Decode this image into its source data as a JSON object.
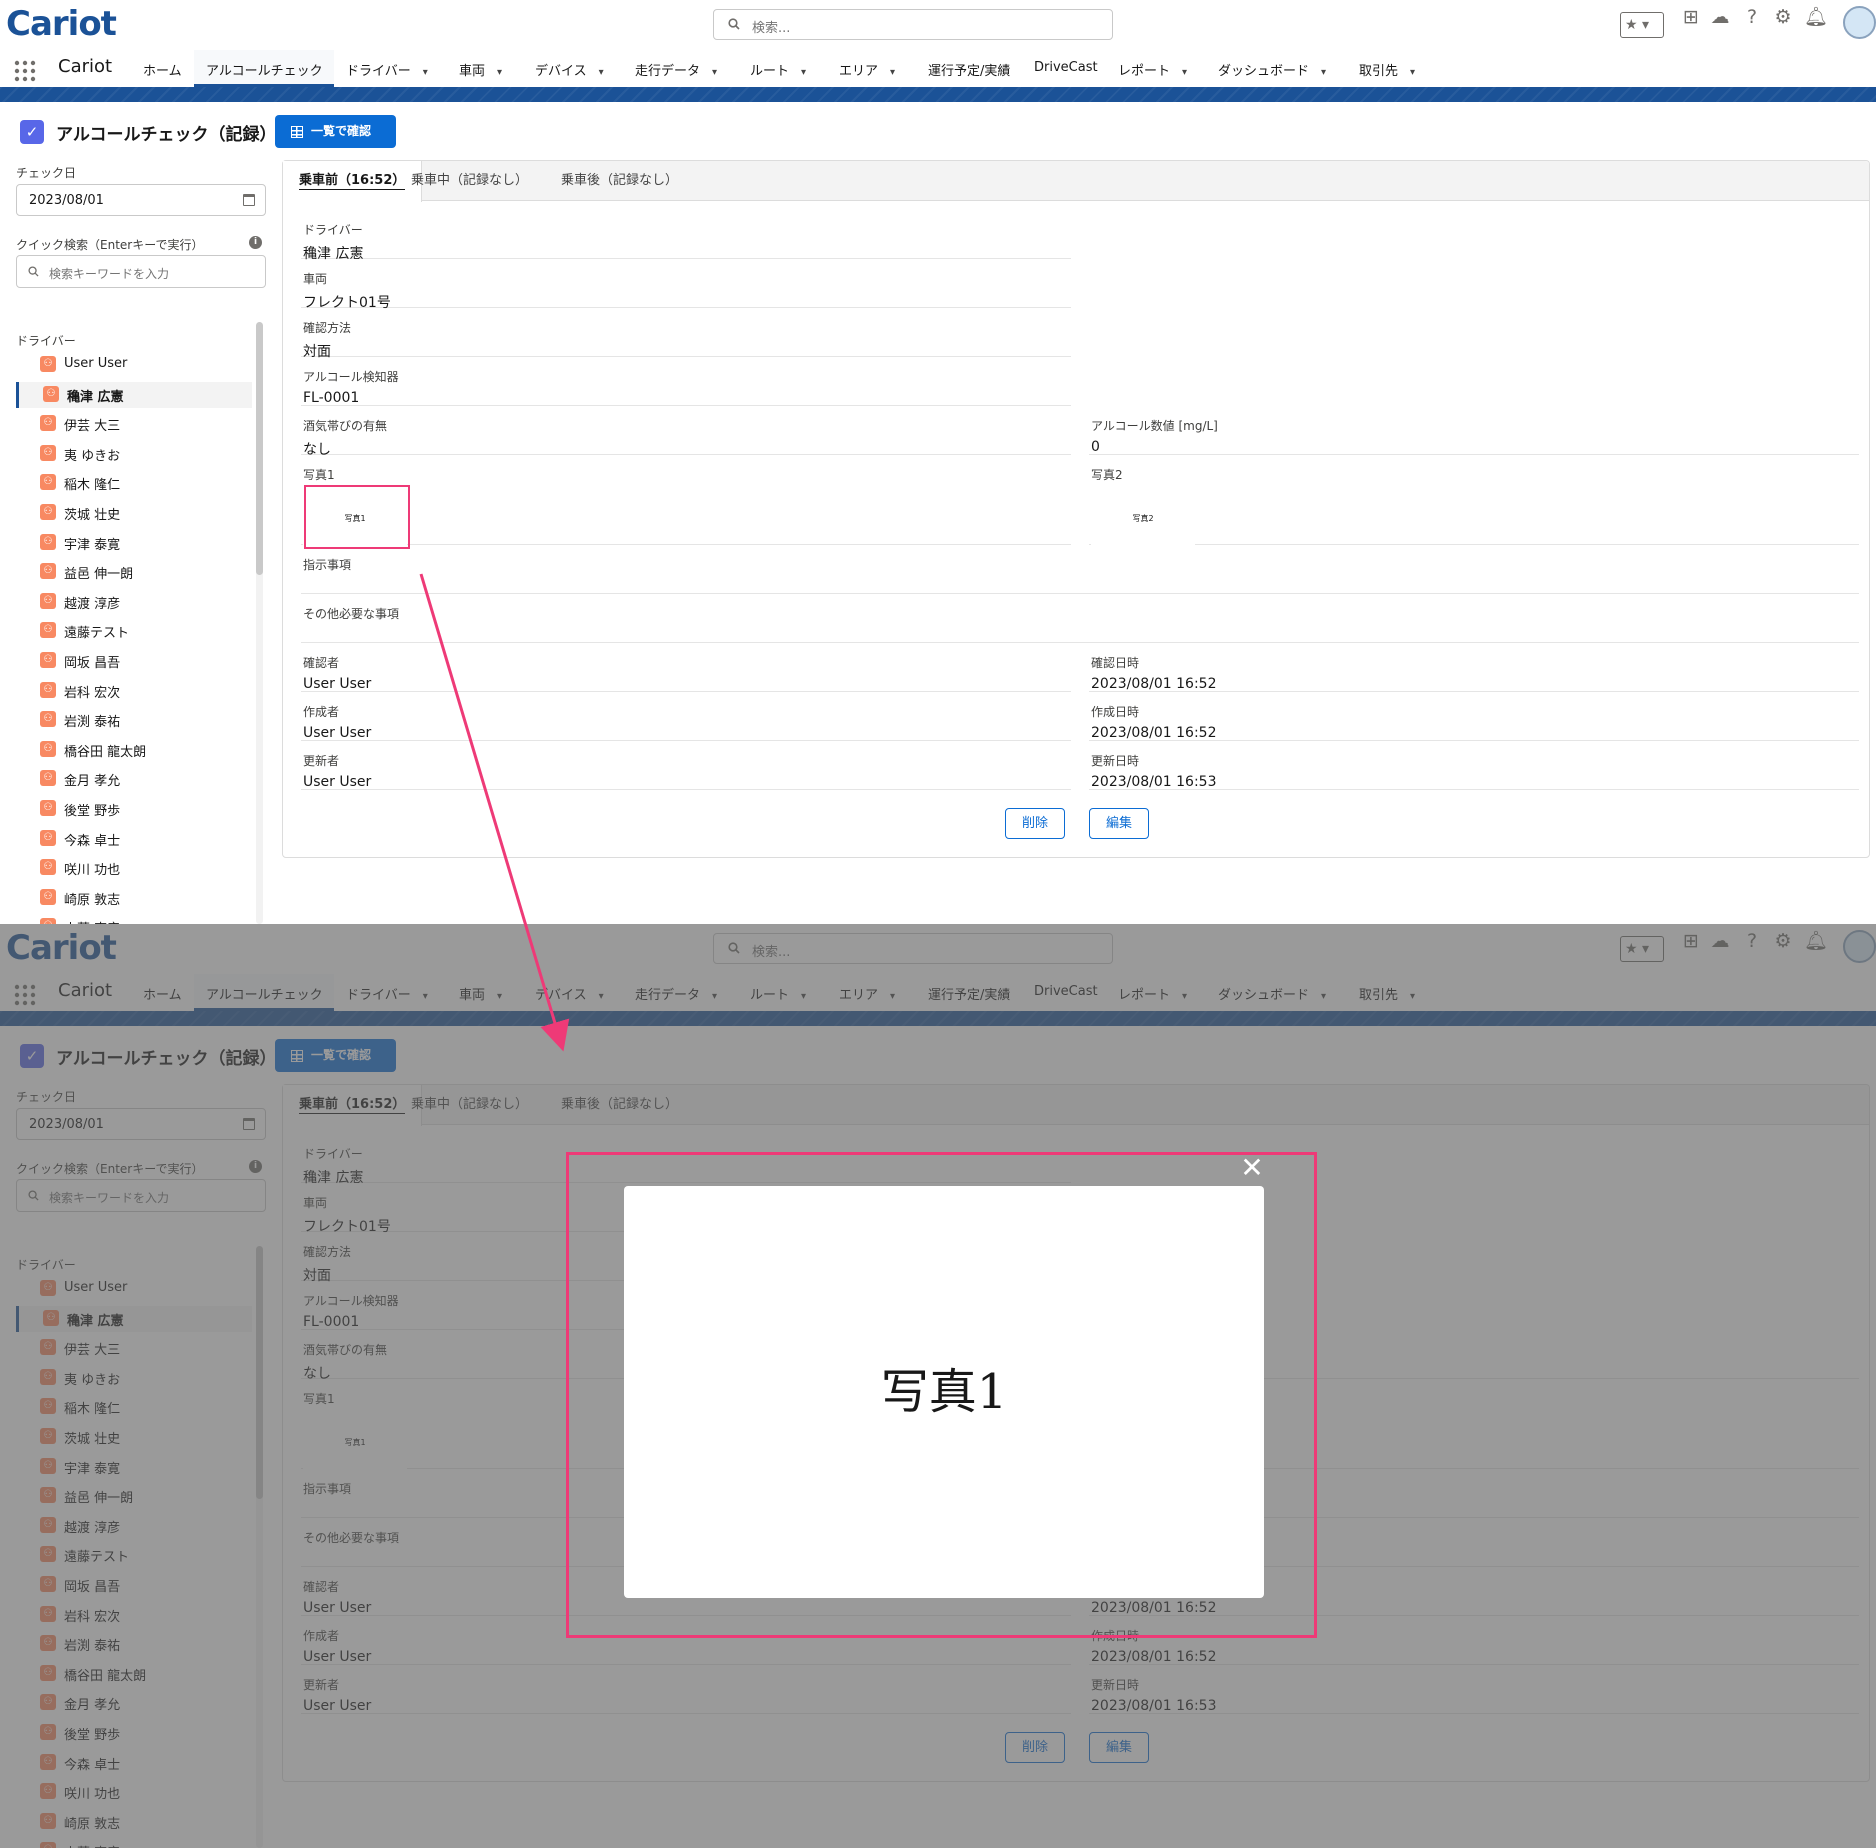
{
  "header": {
    "logo": "Cariot",
    "search_placeholder": "検索..."
  },
  "nav": {
    "app_name": "Cariot",
    "items": [
      {
        "label": "ホーム",
        "dropdown": false
      },
      {
        "label": "アルコールチェック",
        "dropdown": false,
        "active": true
      },
      {
        "label": "ドライバー",
        "dropdown": true
      },
      {
        "label": "車両",
        "dropdown": true
      },
      {
        "label": "デバイス",
        "dropdown": true
      },
      {
        "label": "走行データ",
        "dropdown": true
      },
      {
        "label": "ルート",
        "dropdown": true
      },
      {
        "label": "エリア",
        "dropdown": true
      },
      {
        "label": "運行予定/実績",
        "dropdown": false
      },
      {
        "label": "DriveCast",
        "dropdown": false
      },
      {
        "label": "レポート",
        "dropdown": true
      },
      {
        "label": "ダッシュボード",
        "dropdown": true
      },
      {
        "label": "取引先",
        "dropdown": true
      }
    ]
  },
  "page": {
    "title": "アルコールチェック（記録）",
    "list_button": "一覧で確認",
    "check_date_label": "チェック日",
    "check_date_value": "2023/08/01",
    "quick_search_label": "クイック検索（Enterキーで実行）",
    "quick_search_placeholder": "検索キーワードを入力",
    "driver_section_label": "ドライバー",
    "drivers": [
      "User User",
      "穐津 広憲",
      "伊芸 大三",
      "夷 ゆきお",
      "稲木 隆仁",
      "茨城 壮史",
      "宇津 泰寛",
      "益邑 伸一朗",
      "越渡 淳彦",
      "遠藤テスト",
      "岡坂 昌吾",
      "岩科 宏次",
      "岩渕 泰祐",
      "橋谷田 龍太朗",
      "金月 孝允",
      "後堂 野歩",
      "今森 卓士",
      "咲川 功也",
      "崎原 敦志",
      "山蓉 克彦"
    ],
    "selected_driver": "穐津 広憲"
  },
  "record": {
    "tabs": [
      "乗車前（16:52）",
      "乗車中（記録なし）",
      "乗車後（記録なし）"
    ],
    "driver_label": "ドライバー",
    "driver_value": "穐津 広憲",
    "vehicle_label": "車両",
    "vehicle_value": "フレクト01号",
    "method_label": "確認方法",
    "method_value": "対面",
    "detector_label": "アルコール検知器",
    "detector_value": "FL-0001",
    "alcohol_flag_label": "酒気帯びの有無",
    "alcohol_flag_value": "なし",
    "alcohol_value_label": "アルコール数値 [mg/L]",
    "alcohol_value": "0",
    "photo1_label": "写真1",
    "photo1_thumb": "写真1",
    "photo2_label": "写真2",
    "photo2_thumb": "写真2",
    "instruction_label": "指示事項",
    "other_label": "その他必要な事項",
    "confirmer_label": "確認者",
    "confirmer_value": "User User",
    "confirmed_at_label": "確認日時",
    "confirmed_at_value": "2023/08/01 16:52",
    "creator_label": "作成者",
    "creator_value": "User User",
    "created_at_label": "作成日時",
    "created_at_value": "2023/08/01 16:52",
    "updater_label": "更新者",
    "updater_value": "User User",
    "updated_at_label": "更新日時",
    "updated_at_value": "2023/08/01 16:53",
    "delete_button": "削除",
    "edit_button": "編集"
  },
  "modal": {
    "image_text": "写真1",
    "close_symbol": "✕"
  },
  "colors": {
    "brand": "#1b5297",
    "primary_button": "#0b6cd4",
    "highlight": "#ee3a77",
    "driver_icon": "#f88962"
  }
}
